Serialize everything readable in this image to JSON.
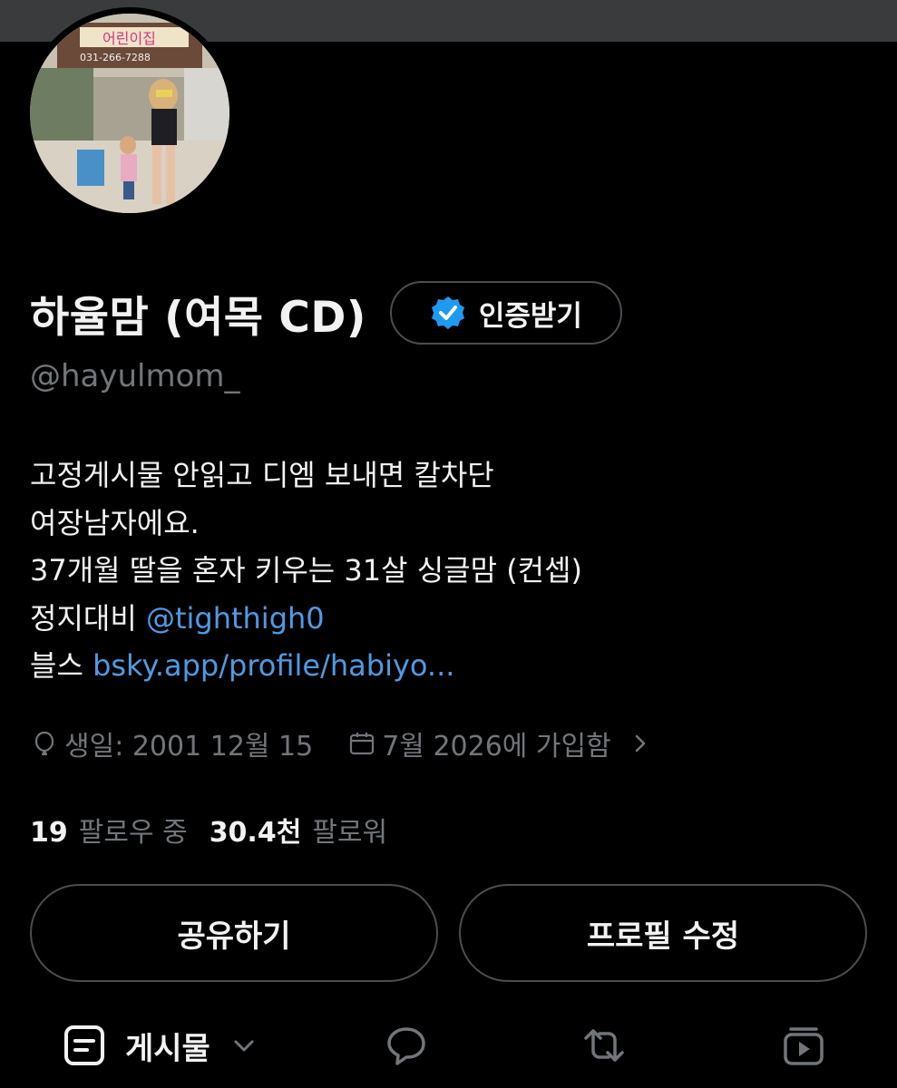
{
  "profile": {
    "display_name": "하율맘 (여목 CD)",
    "verify_label": "인증받기",
    "handle": "@hayulmom_",
    "avatar_sign": "어린이집",
    "avatar_phone": "031-266-7288"
  },
  "bio": {
    "line1": "고정게시물 안읽고 디엠 보내면 칼차단",
    "line2": "여장남자에요.",
    "line3": "37개월 딸을 혼자 키우는 31살 싱글맘 (컨셉)",
    "line4_prefix": "정지대비 ",
    "line4_link": "@tighthigh0",
    "line5_prefix": "블스 ",
    "line5_link": "bsky.app/profile/habiyo..."
  },
  "meta": {
    "birthday": "생일: 2001 12월 15",
    "joined": "7월 2026에 가입함"
  },
  "stats": {
    "following_count": "19",
    "following_label": "팔로우 중",
    "followers_count": "30.4천",
    "followers_label": "팔로워"
  },
  "actions": {
    "share_label": "공유하기",
    "edit_label": "프로필 수정"
  },
  "tabs": {
    "posts_label": "게시물"
  },
  "colors": {
    "background": "#000000",
    "link": "#4c9be6",
    "muted": "#71767b",
    "verified_badge": "#1d9bf0"
  }
}
